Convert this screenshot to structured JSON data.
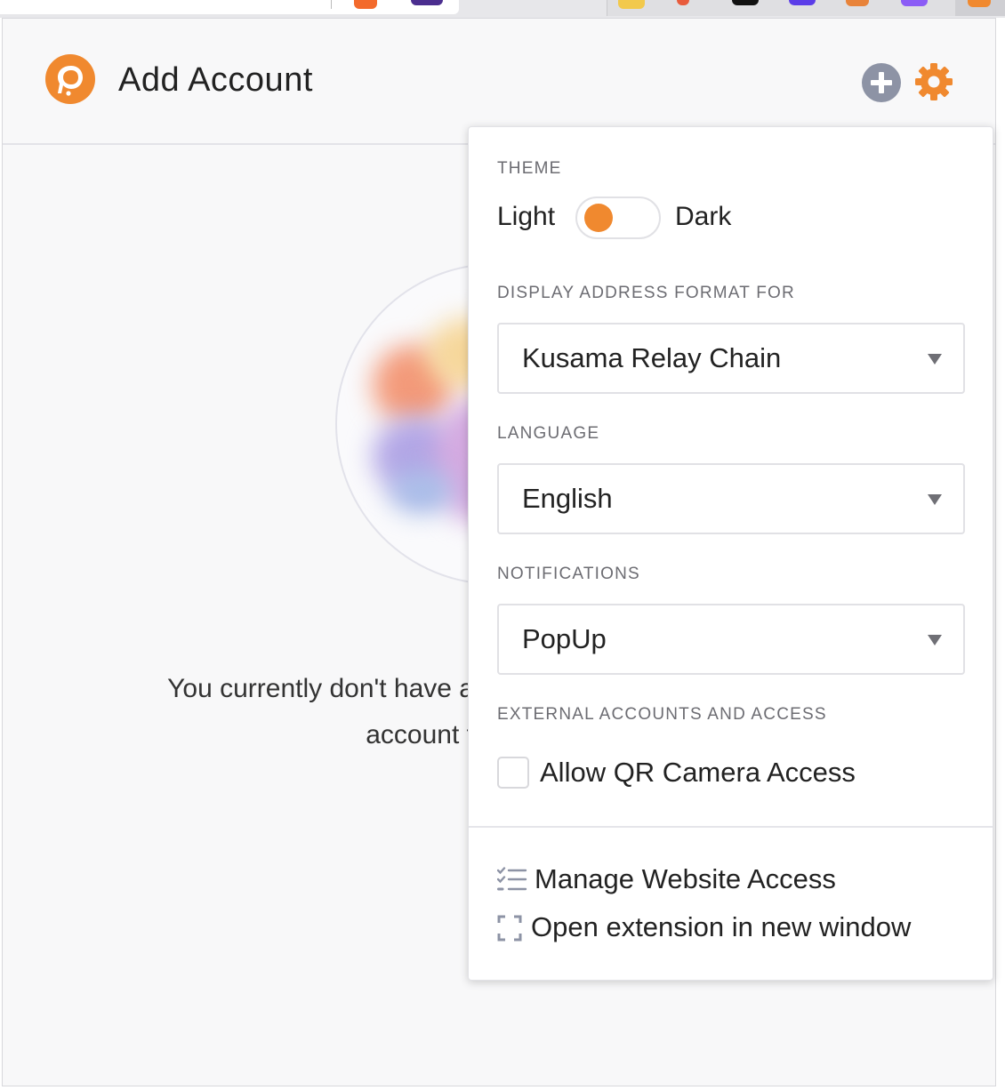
{
  "popup": {
    "title": "Add Account",
    "icons": {
      "logo": "polkadot-logo-icon",
      "add": "plus-circle-icon",
      "settings": "gear-icon"
    },
    "empty_message_line1": "You currently don't have a",
    "empty_message_line2": "account t"
  },
  "settings_menu": {
    "theme": {
      "label": "THEME",
      "light_label": "Light",
      "dark_label": "Dark",
      "state": "light"
    },
    "address_format": {
      "label": "DISPLAY ADDRESS FORMAT FOR",
      "value": "Kusama Relay Chain"
    },
    "language": {
      "label": "LANGUAGE",
      "value": "English"
    },
    "notifications": {
      "label": "NOTIFICATIONS",
      "value": "PopUp"
    },
    "external": {
      "label": "EXTERNAL ACCOUNTS AND ACCESS",
      "qr_label": "Allow QR Camera Access",
      "qr_checked": false
    },
    "links": {
      "manage_access": "Manage Website Access",
      "open_window": "Open extension in new window"
    }
  },
  "colors": {
    "accent": "#f0892f",
    "icon_gray": "#8d93a5"
  }
}
